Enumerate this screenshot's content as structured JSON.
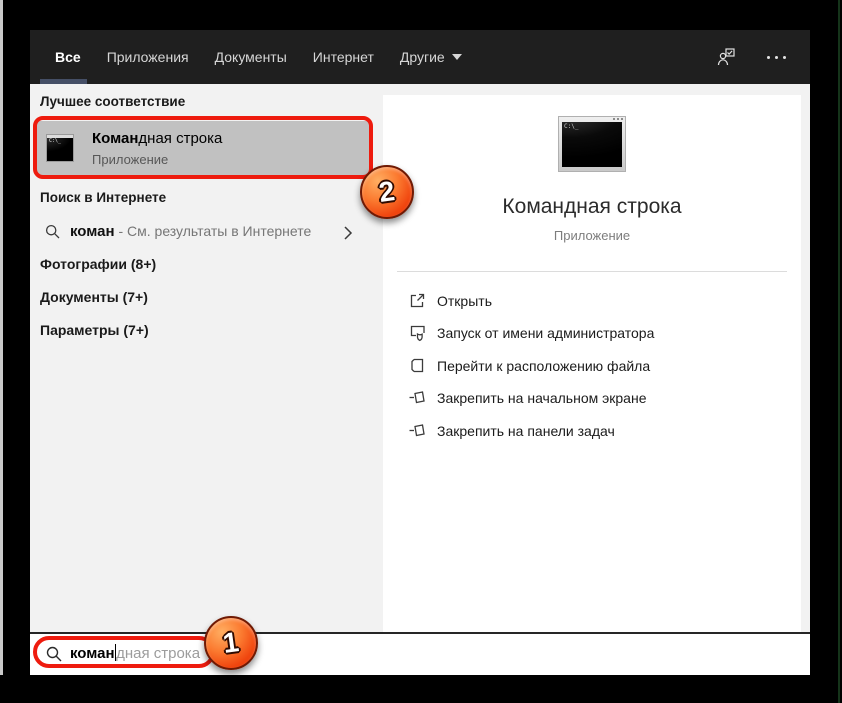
{
  "tabs": {
    "items": [
      {
        "label": "Все",
        "active": true
      },
      {
        "label": "Приложения",
        "active": false
      },
      {
        "label": "Документы",
        "active": false
      },
      {
        "label": "Интернет",
        "active": false
      },
      {
        "label": "Другие",
        "active": false,
        "has_dropdown": true
      }
    ],
    "right_icons": [
      {
        "name": "user-feedback-icon"
      },
      {
        "name": "ellipsis-icon"
      }
    ]
  },
  "left_panel": {
    "best_match_header": "Лучшее соответствие",
    "best_match": {
      "title_bold": "Коман",
      "title_rest": "дная строка",
      "subtitle": "Приложение",
      "icon": "cmd-icon"
    },
    "web_search_header": "Поиск в Интернете",
    "web_suggestion": {
      "term": "коман",
      "rest": " - См. результаты в Интернете",
      "icon": "search-icon",
      "chevron": "chevron-right-icon"
    },
    "groups": [
      {
        "label": "Фотографии (8+)"
      },
      {
        "label": "Документы (7+)"
      },
      {
        "label": "Параметры (7+)"
      }
    ]
  },
  "preview": {
    "icon": "cmd-icon",
    "icon_prompt_text": "C:\\_",
    "title": "Командная строка",
    "subtitle": "Приложение",
    "actions": [
      {
        "label": "Открыть",
        "icon": "open-icon"
      },
      {
        "label": "Запуск от имени администратора",
        "icon": "admin-shield-icon"
      },
      {
        "label": "Перейти к расположению файла",
        "icon": "file-location-icon"
      },
      {
        "label": "Закрепить на начальном экране",
        "icon": "pin-icon"
      },
      {
        "label": "Закрепить на панели задач",
        "icon": "pin-icon"
      }
    ]
  },
  "search_bar": {
    "typed": "коман",
    "suggestion": "дная строка",
    "icon": "search-icon"
  },
  "annotations": {
    "step1": "1",
    "step2": "2",
    "highlight_color": "#ee1b0e"
  },
  "colors": {
    "tabbar_bg": "#1f1f1f",
    "active_tab_underline": "#454f66",
    "panel_bg": "#f2f2f2",
    "selected_item_bg": "#c1c1c1",
    "card_bg": "#ffffff"
  }
}
